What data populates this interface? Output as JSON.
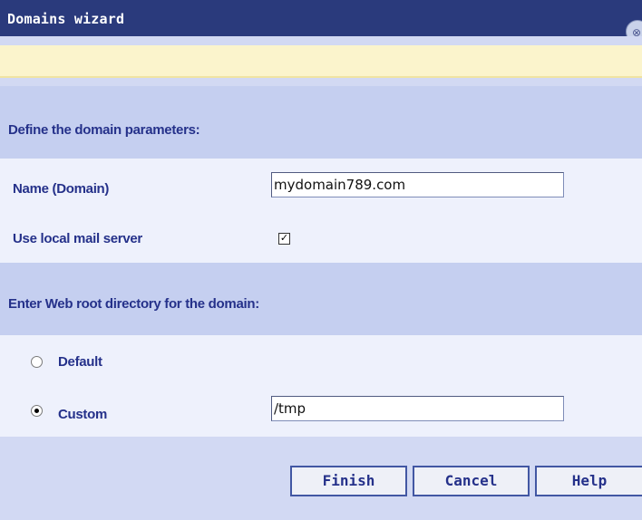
{
  "window": {
    "title": "Domains wizard",
    "close_glyph": "⊗"
  },
  "section_domain": {
    "heading": "Define the domain parameters:",
    "name_label": "Name (Domain)",
    "name_value": "mydomain789.com",
    "mail_label": "Use local mail server",
    "mail_checked": true
  },
  "section_webroot": {
    "heading": "Enter Web root directory for the domain:",
    "default_label": "Default",
    "default_selected": false,
    "custom_label": "Custom",
    "custom_selected": true,
    "custom_value": "/tmp"
  },
  "buttons": {
    "finish": "Finish",
    "cancel": "Cancel",
    "help": "Help"
  },
  "colors": {
    "titlebar": "#2a3a7c",
    "label_text": "#25318a",
    "section_header": "#c5cff0",
    "alert_bar": "#fbf4cc"
  }
}
